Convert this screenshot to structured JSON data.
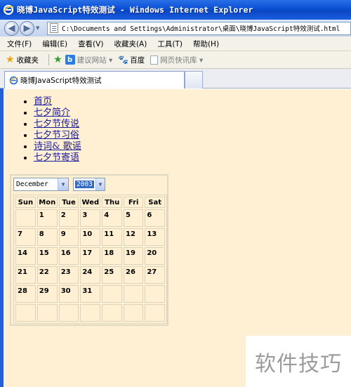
{
  "window": {
    "title": "晓博JavaScript特效测试 - Windows Internet Explorer",
    "address": "C:\\Documents and Settings\\Administrator\\桌面\\晓博JavaScript特效测试.html"
  },
  "menu": [
    "文件(F)",
    "编辑(E)",
    "查看(V)",
    "收藏夹(A)",
    "工具(T)",
    "帮助(H)"
  ],
  "favorites_bar": {
    "favorites_label": "收藏夹",
    "items": [
      {
        "label": "建议网站 ▾",
        "enabled": false
      },
      {
        "label": "百度",
        "enabled": true
      },
      {
        "label": "网页快讯库 ▾",
        "enabled": false
      }
    ]
  },
  "tab": {
    "title": "晓博JavaScript特效测试"
  },
  "nav_links": [
    "首页",
    "七夕简介",
    "七夕节传说",
    "七夕节习俗",
    "诗词& 歌谣",
    "七夕节寄语"
  ],
  "calendar": {
    "month": "December",
    "year": "2003",
    "weekdays": [
      "Sun",
      "Mon",
      "Tue",
      "Wed",
      "Thu",
      "Fri",
      "Sat"
    ],
    "weeks": [
      [
        "",
        "1",
        "2",
        "3",
        "4",
        "5",
        "6"
      ],
      [
        "7",
        "8",
        "9",
        "10",
        "11",
        "12",
        "13"
      ],
      [
        "14",
        "15",
        "16",
        "17",
        "18",
        "19",
        "20"
      ],
      [
        "21",
        "22",
        "23",
        "24",
        "25",
        "26",
        "27"
      ],
      [
        "28",
        "29",
        "30",
        "31",
        "",
        "",
        ""
      ],
      [
        "",
        "",
        "",
        "",
        "",
        "",
        ""
      ]
    ]
  },
  "watermark": "软件技巧",
  "colors": {
    "titlebar": "#0a4fd3",
    "page_bg": "#fff0d3",
    "link": "#1a1a9a"
  }
}
